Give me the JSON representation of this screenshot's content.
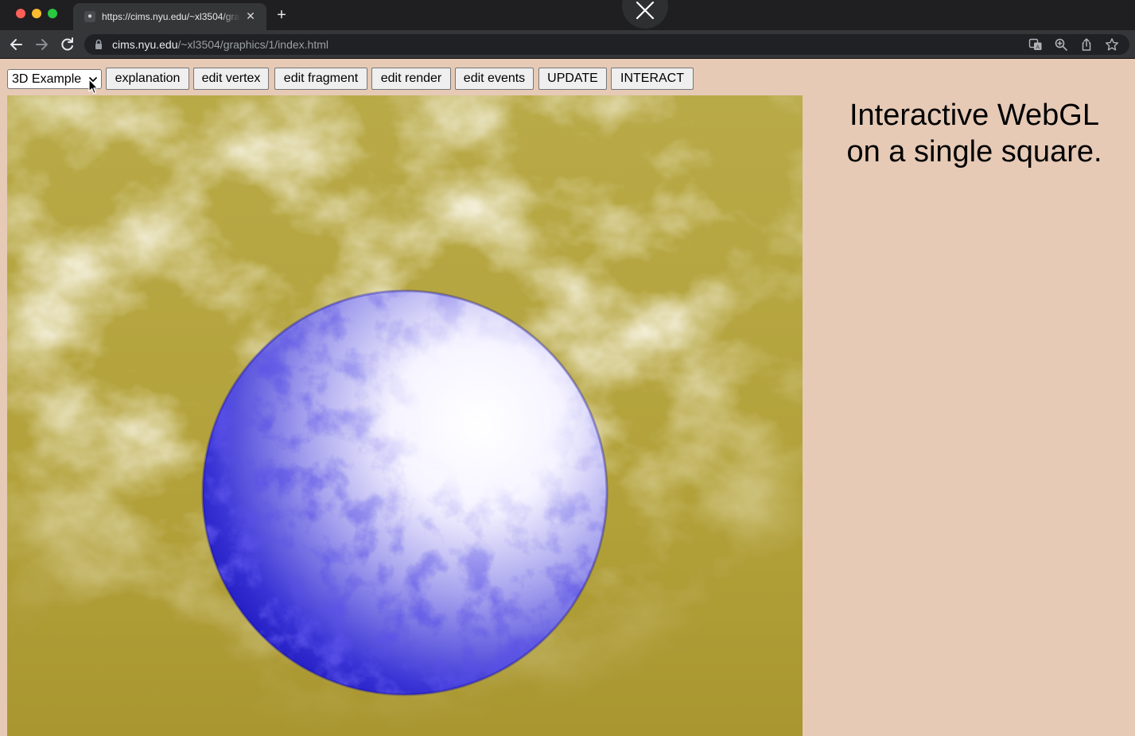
{
  "browser": {
    "tab": {
      "title": "https://cims.nyu.edu/~xl3504/graphics/1/index.html",
      "favicon": "globe-icon"
    },
    "address": {
      "host": "cims.nyu.edu",
      "path": "/~xl3504/graphics/1/index.html"
    }
  },
  "controls": {
    "example_select": {
      "value": "3D Example"
    },
    "buttons": {
      "explanation": "explanation",
      "edit_vertex": "edit vertex",
      "edit_fragment": "edit fragment",
      "edit_render": "edit render",
      "edit_events": "edit events",
      "update": "UPDATE",
      "interact": "INTERACT"
    }
  },
  "headline": {
    "line1": "Interactive WebGL",
    "line2": "on a single square."
  },
  "colors": {
    "page_background": "#e6cab6",
    "canvas_background": "#b5a43a",
    "sphere_dark": "#1010c8",
    "sphere_light": "#ffffff"
  }
}
